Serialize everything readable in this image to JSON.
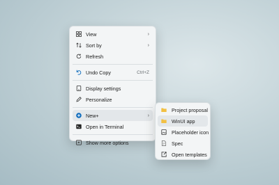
{
  "context_menu": {
    "items": [
      {
        "label": "View",
        "icon": "grid-icon"
      },
      {
        "label": "Sort by",
        "icon": "sort-icon"
      },
      {
        "label": "Refresh",
        "icon": "refresh-icon"
      },
      {
        "label": "Undo Copy",
        "icon": "undo-icon",
        "shortcut": "Ctrl+Z"
      },
      {
        "label": "Display settings",
        "icon": "display-icon"
      },
      {
        "label": "Personalize",
        "icon": "pencil-icon"
      },
      {
        "label": "New+",
        "icon": "plus-circle-icon"
      },
      {
        "label": "Open in Terminal",
        "icon": "terminal-icon"
      },
      {
        "label": "Show more options",
        "icon": "more-options-icon"
      }
    ]
  },
  "submenu": {
    "items": [
      {
        "label": "Project proposal",
        "icon": "folder-icon"
      },
      {
        "label": "WinUI app",
        "icon": "folder-icon"
      },
      {
        "label": "Placeholder icon",
        "icon": "image-icon"
      },
      {
        "label": "Spec",
        "icon": "document-icon"
      },
      {
        "label": "Open templates",
        "icon": "open-external-icon"
      }
    ]
  },
  "colors": {
    "accent": "#0f6cbd",
    "folder": "#f2c043",
    "menu_background": "#f3f5f6",
    "hover": "#e3e7ea"
  }
}
